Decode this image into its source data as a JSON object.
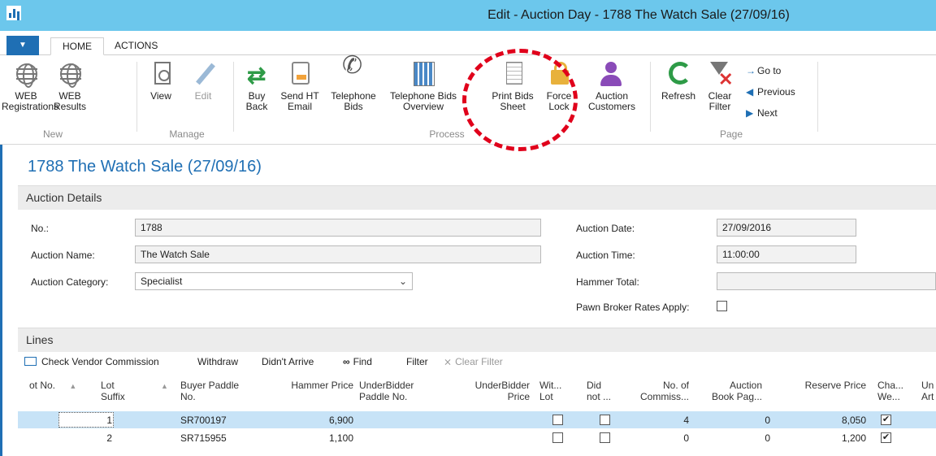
{
  "window": {
    "title": "Edit - Auction Day - 1788 The Watch Sale (27/09/16)"
  },
  "tabs": [
    {
      "label": "HOME"
    },
    {
      "label": "ACTIONS"
    }
  ],
  "ribbon": {
    "groups": [
      {
        "label": "New"
      },
      {
        "label": "Manage"
      },
      {
        "label": "Process"
      },
      {
        "label": "Page"
      }
    ],
    "buttons": {
      "web_registrations": [
        "WEB",
        "Registrations"
      ],
      "web_results": [
        "WEB",
        "Results"
      ],
      "view": [
        "View"
      ],
      "edit": [
        "Edit"
      ],
      "buy_back": [
        "Buy",
        "Back"
      ],
      "send_ht_email": [
        "Send HT",
        "Email"
      ],
      "telephone_bids": [
        "Telephone",
        "Bids"
      ],
      "telephone_bids_overview": [
        "Telephone Bids",
        "Overview"
      ],
      "print_bids_sheet": [
        "Print Bids",
        "Sheet"
      ],
      "force_lock": [
        "Force",
        "Lock"
      ],
      "auction_customers": [
        "Auction",
        "Customers"
      ],
      "refresh": [
        "Refresh"
      ],
      "clear_filter": [
        "Clear",
        "Filter"
      ]
    },
    "nav": {
      "goto": "Go to",
      "previous": "Previous",
      "next": "Next"
    }
  },
  "page_title": "1788 The Watch Sale (27/09/16)",
  "auction_details": {
    "section_label": "Auction Details",
    "no_label": "No.:",
    "no_value": "1788",
    "name_label": "Auction Name:",
    "name_value": "The Watch Sale",
    "category_label": "Auction Category:",
    "category_value": "Specialist",
    "date_label": "Auction Date:",
    "date_value": "27/09/2016",
    "time_label": "Auction Time:",
    "time_value": "11:00:00",
    "hammer_total_label": "Hammer Total:",
    "hammer_total_value": "",
    "pawn_label": "Pawn Broker Rates Apply:",
    "pawn_checked": false
  },
  "lines": {
    "section_label": "Lines",
    "toolbar": {
      "check_vendor_commission": "Check Vendor Commission",
      "withdraw": "Withdraw",
      "didnt_arrive": "Didn't Arrive",
      "find": "Find",
      "filter": "Filter",
      "clear_filter": "Clear Filter"
    },
    "columns": {
      "lot_no": "ot No.",
      "lot_suffix": [
        "Lot",
        "Suffix"
      ],
      "buyer_paddle": [
        "Buyer Paddle",
        "No."
      ],
      "hammer_price": "Hammer Price",
      "underbidder_paddle": [
        "UnderBidder",
        "Paddle No."
      ],
      "underbidder_price": [
        "UnderBidder",
        "Price"
      ],
      "withdrawn": [
        "Wit...",
        "Lot"
      ],
      "did_not": [
        "Did",
        "not ..."
      ],
      "no_commission": [
        "No. of",
        "Commiss..."
      ],
      "book_page": [
        "Auction",
        "Book Pag..."
      ],
      "reserve_price": "Reserve Price",
      "charge": [
        "Cha...",
        "We..."
      ],
      "un": [
        "Un",
        "Art"
      ]
    },
    "rows": [
      {
        "lot_no": "1",
        "buyer_paddle": "SR700197",
        "hammer_price": "6,900",
        "no_commission": "4",
        "book_page": "0",
        "reserve_price": "8,050",
        "charge": "✔"
      },
      {
        "lot_no": "2",
        "buyer_paddle": "SR715955",
        "hammer_price": "1,100",
        "no_commission": "0",
        "book_page": "0",
        "reserve_price": "1,200",
        "charge": "✔"
      }
    ]
  },
  "colors": {
    "titlebar": "#6cc7ec",
    "accent": "#1f6fb4",
    "highlight_annotation": "#e0001b",
    "selected_row": "#c7e3f7"
  }
}
